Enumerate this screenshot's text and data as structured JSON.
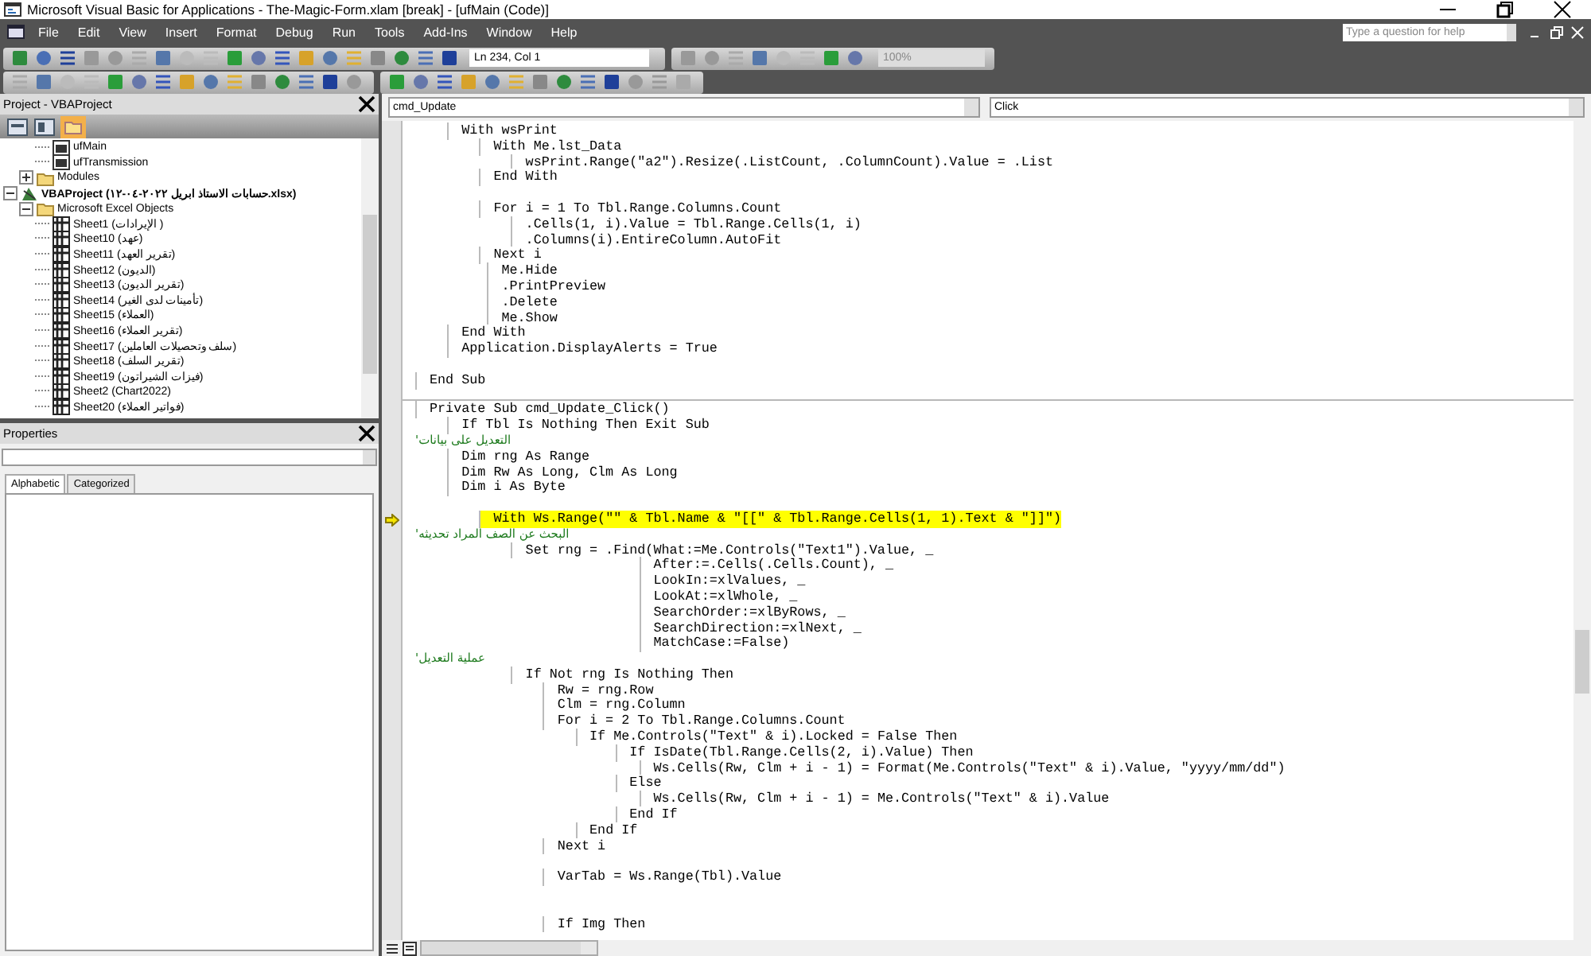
{
  "window": {
    "title": "Microsoft Visual Basic for Applications - The-Magic-Form.xlam [break] - [ufMain (Code)]"
  },
  "menu": [
    "File",
    "Edit",
    "View",
    "Insert",
    "Format",
    "Debug",
    "Run",
    "Tools",
    "Add-Ins",
    "Window",
    "Help"
  ],
  "help_search": {
    "placeholder": "Type a question for help"
  },
  "toolbar": {
    "position": "Ln 234, Col 1",
    "zoom": "100%"
  },
  "project_pane": {
    "title": "Project - VBAProject",
    "tree": [
      {
        "children": [
          {
            "children": [
              {
                "label": "ufMain",
                "kind": "form"
              },
              {
                "label": "ufTransmission",
                "kind": "form"
              }
            ]
          },
          {
            "label": "Modules",
            "kind": "folder",
            "expanded": false
          }
        ]
      },
      {
        "label": "VBAProject (حسابات الاستاذ ابريل ٢٠٢٢-٠٤-١٢.xlsx)",
        "kind": "project",
        "expanded": true,
        "children": [
          {
            "label": "Microsoft Excel Objects",
            "kind": "folder",
            "expanded": true,
            "children": [
              {
                "label": "Sheet1 (الإيرادات )",
                "kind": "sheet"
              },
              {
                "label": "Sheet10 (عهد)",
                "kind": "sheet"
              },
              {
                "label": "Sheet11 (تقرير العهد)",
                "kind": "sheet"
              },
              {
                "label": "Sheet12 (الديون)",
                "kind": "sheet"
              },
              {
                "label": "Sheet13 (تقرير الديون)",
                "kind": "sheet"
              },
              {
                "label": "Sheet14 (تأمينات لدى الغير)",
                "kind": "sheet"
              },
              {
                "label": "Sheet15 (العملاء)",
                "kind": "sheet"
              },
              {
                "label": "Sheet16 (تقرير العملاء)",
                "kind": "sheet"
              },
              {
                "label": "Sheet17 (سلف وتحصيلات العاملين)",
                "kind": "sheet"
              },
              {
                "label": "Sheet18 (تقرير السلف)",
                "kind": "sheet"
              },
              {
                "label": "Sheet19 (فيزات الشيراتون)",
                "kind": "sheet"
              },
              {
                "label": "Sheet2 (Chart2022)",
                "kind": "sheet"
              },
              {
                "label": "Sheet20 (فواتير العملاء)",
                "kind": "sheet"
              }
            ]
          }
        ]
      }
    ]
  },
  "properties_pane": {
    "title": "Properties",
    "tabs": [
      {
        "label": "Alphabetic",
        "selected": true
      },
      {
        "label": "Categorized",
        "selected": false
      }
    ]
  },
  "code_window": {
    "object": "cmd_Update",
    "procedure": "Click",
    "lines": [
      {
        "kind": "code",
        "text": "    With wsPrint",
        "current": false
      },
      {
        "kind": "code",
        "text": "        With Me.lst_Data",
        "current": false
      },
      {
        "kind": "code",
        "text": "            wsPrint.Range(\"a2\").Resize(.ListCount, .ColumnCount).Value = .List",
        "current": false
      },
      {
        "kind": "code",
        "text": "        End With",
        "current": false
      },
      {
        "kind": "blank",
        "current": false
      },
      {
        "kind": "code",
        "text": "        For i = 1 To Tbl.Range.Columns.Count",
        "current": false
      },
      {
        "kind": "code",
        "text": "            .Cells(1, i).Value = Tbl.Range.Cells(1, i)",
        "current": false
      },
      {
        "kind": "code",
        "text": "            .Columns(i).EntireColumn.AutoFit",
        "current": false
      },
      {
        "kind": "code",
        "text": "        Next i",
        "current": false
      },
      {
        "kind": "code",
        "text": "         Me.Hide",
        "current": false
      },
      {
        "kind": "code",
        "text": "         .PrintPreview",
        "current": false
      },
      {
        "kind": "code",
        "text": "         .Delete",
        "current": false
      },
      {
        "kind": "code",
        "text": "         Me.Show",
        "current": false
      },
      {
        "kind": "code",
        "text": "    End With",
        "current": false
      },
      {
        "kind": "code",
        "text": "    Application.DisplayAlerts = True",
        "current": false
      },
      {
        "kind": "blank",
        "current": false
      },
      {
        "kind": "code",
        "text": "End Sub",
        "current": false
      },
      {
        "kind": "separator",
        "current": false
      },
      {
        "kind": "code",
        "text": "Private Sub cmd_Update_Click()",
        "current": false
      },
      {
        "kind": "code",
        "text": "    If Tbl Is Nothing Then Exit Sub",
        "current": false
      },
      {
        "kind": "comment",
        "text": "'التعديل على بيانات",
        "current": false
      },
      {
        "kind": "code",
        "text": "    Dim rng As Range",
        "current": false
      },
      {
        "kind": "code",
        "text": "    Dim Rw As Long, Clm As Long",
        "current": false
      },
      {
        "kind": "code",
        "text": "    Dim i As Byte",
        "current": false
      },
      {
        "kind": "blank",
        "current": false
      },
      {
        "kind": "code",
        "text": "        With Ws.Range(\"\" & Tbl.Name & \"[[\" & Tbl.Range.Cells(1, 1).Text & \"]]\")",
        "current": true
      },
      {
        "kind": "comment",
        "text": "'البحث عن الصف المراد تحديثه",
        "current": false
      },
      {
        "kind": "code",
        "text": "            Set rng = .Find(What:=Me.Controls(\"Text1\").Value, _",
        "current": false
      },
      {
        "kind": "code",
        "text": "                            After:=.Cells(.Cells.Count), _",
        "current": false
      },
      {
        "kind": "code",
        "text": "                            LookIn:=xlValues, _",
        "current": false
      },
      {
        "kind": "code",
        "text": "                            LookAt:=xlWhole, _",
        "current": false
      },
      {
        "kind": "code",
        "text": "                            SearchOrder:=xlByRows, _",
        "current": false
      },
      {
        "kind": "code",
        "text": "                            SearchDirection:=xlNext, _",
        "current": false
      },
      {
        "kind": "code",
        "text": "                            MatchCase:=False)",
        "current": false
      },
      {
        "kind": "comment",
        "text": "'عملية التعديل",
        "current": false
      },
      {
        "kind": "code",
        "text": "            If Not rng Is Nothing Then",
        "current": false
      },
      {
        "kind": "code",
        "text": "                Rw = rng.Row",
        "current": false
      },
      {
        "kind": "code",
        "text": "                Clm = rng.Column",
        "current": false
      },
      {
        "kind": "code",
        "text": "                For i = 2 To Tbl.Range.Columns.Count",
        "current": false
      },
      {
        "kind": "code",
        "text": "                    If Me.Controls(\"Text\" & i).Locked = False Then",
        "current": false
      },
      {
        "kind": "code",
        "text": "                         If IsDate(Tbl.Range.Cells(2, i).Value) Then",
        "current": false
      },
      {
        "kind": "code",
        "text": "                            Ws.Cells(Rw, Clm + i - 1) = Format(Me.Controls(\"Text\" & i).Value, \"yyyy/mm/dd\")",
        "current": false
      },
      {
        "kind": "code",
        "text": "                         Else",
        "current": false
      },
      {
        "kind": "code",
        "text": "                            Ws.Cells(Rw, Clm + i - 1) = Me.Controls(\"Text\" & i).Value",
        "current": false
      },
      {
        "kind": "code",
        "text": "                         End If",
        "current": false
      },
      {
        "kind": "code",
        "text": "                    End If",
        "current": false
      },
      {
        "kind": "code",
        "text": "                Next i",
        "current": false
      },
      {
        "kind": "blank",
        "current": false
      },
      {
        "kind": "code",
        "text": "                VarTab = Ws.Range(Tbl).Value",
        "current": false
      },
      {
        "kind": "blank",
        "current": false
      },
      {
        "kind": "blank",
        "current": false
      },
      {
        "kind": "code",
        "text": "                If Img Then",
        "current": false
      }
    ]
  }
}
